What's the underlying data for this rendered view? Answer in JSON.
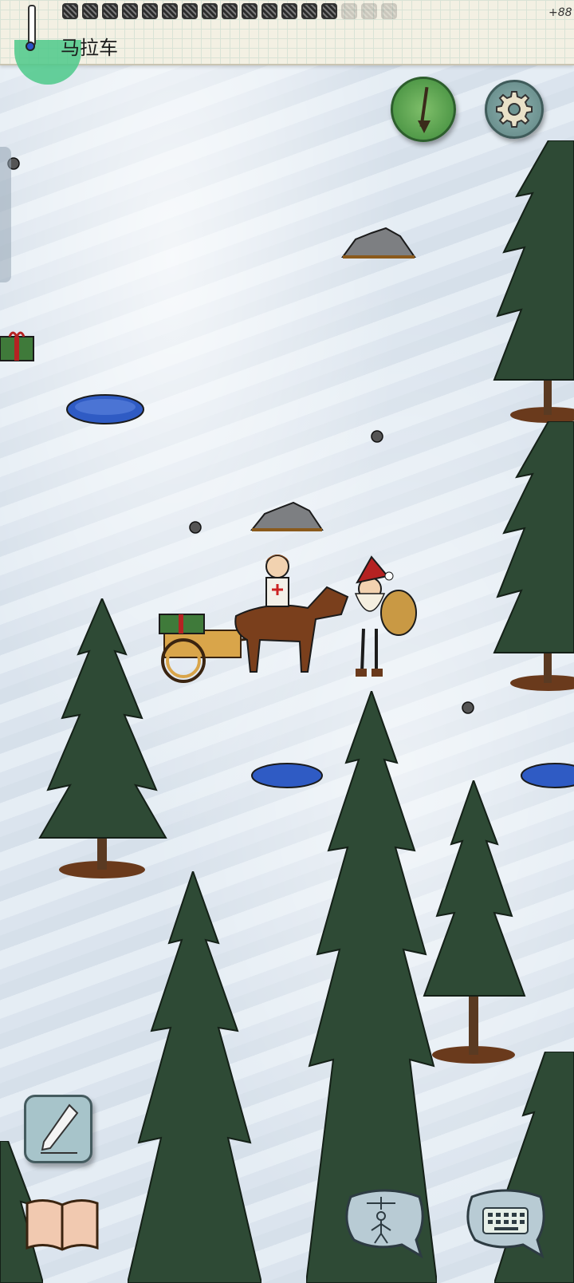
{
  "status_bar": {
    "location": "马拉车",
    "counter": "+88",
    "inventory_slots": 17,
    "inventory_faded": 3
  },
  "buttons": {
    "compass": "compass-icon",
    "settings": "gear-icon",
    "journal": "pencil-icon",
    "book": "book-icon",
    "puppet": "marionette-icon",
    "keyboard": "keyboard-icon"
  },
  "colors": {
    "snow": "#dfe8f0",
    "tree": "#2e4a35",
    "compass": "#4e9a47",
    "settings": "#6f9593",
    "water": "#2f5bc4"
  }
}
